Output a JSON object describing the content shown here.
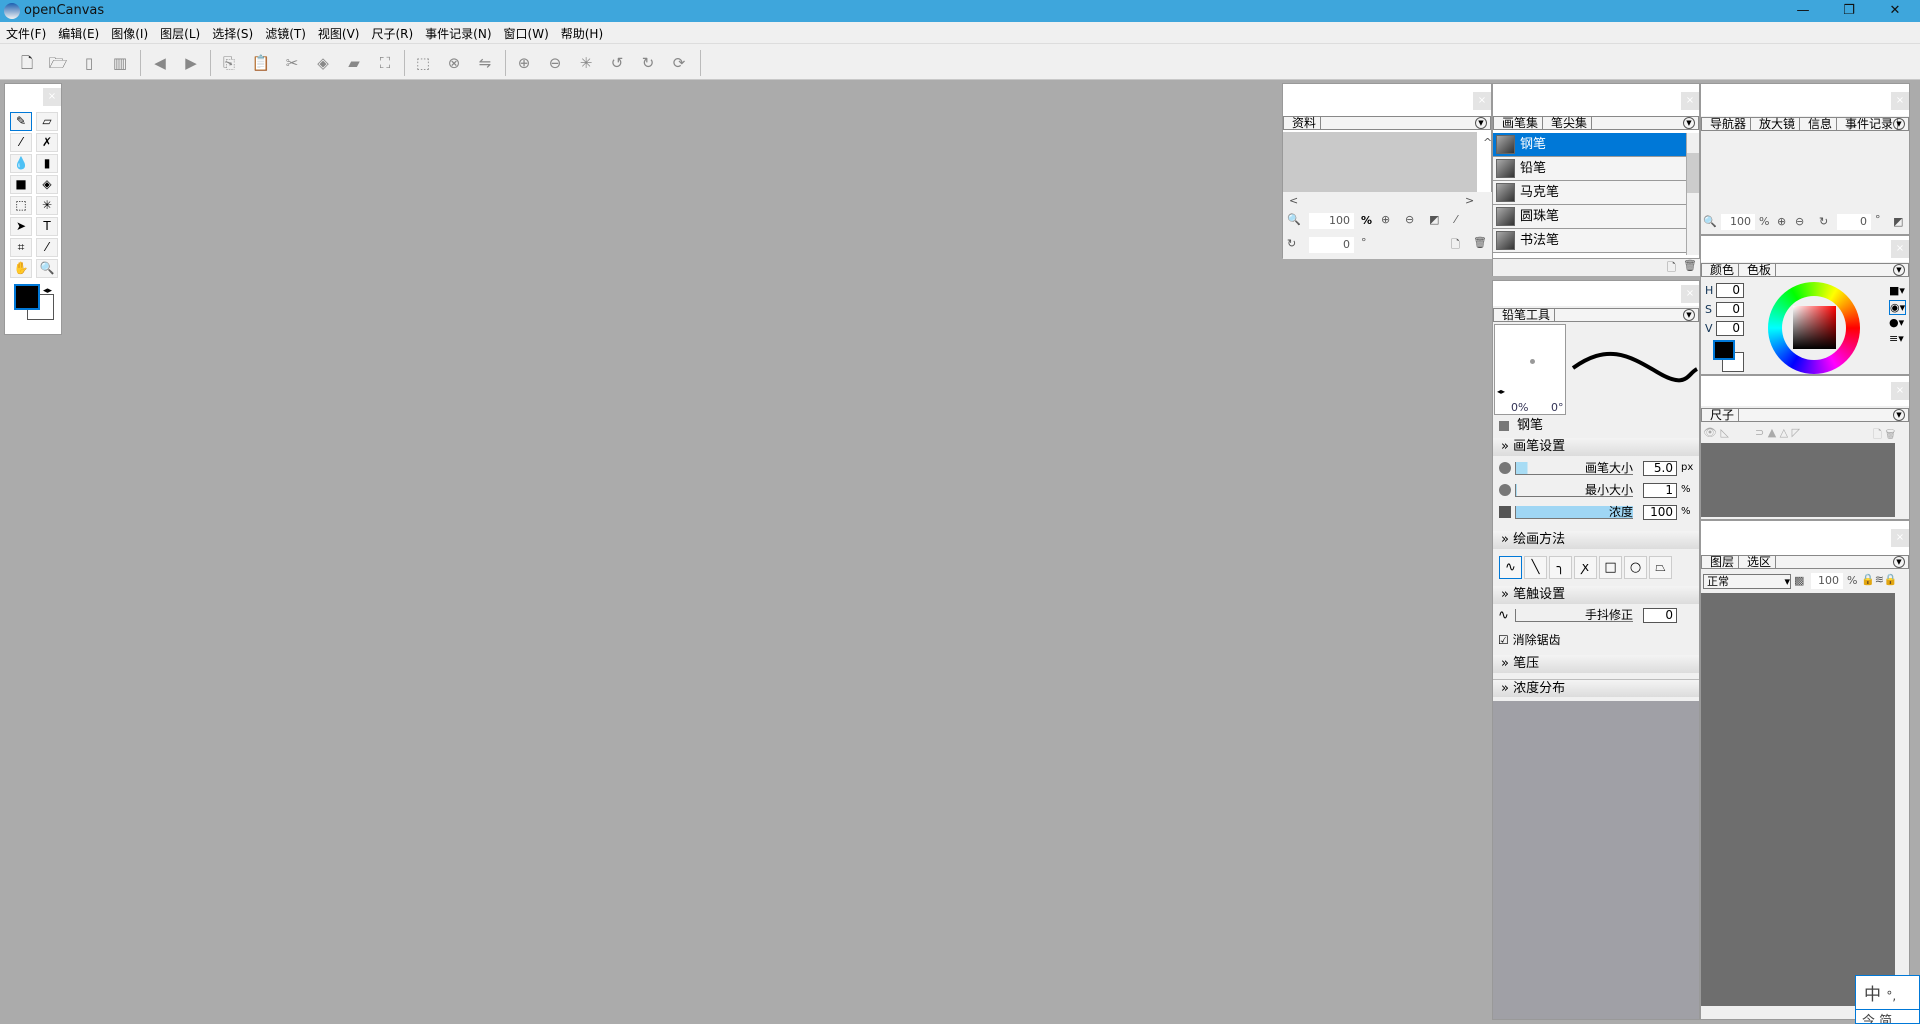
{
  "title": "openCanvas",
  "menu": [
    "文件(F)",
    "编辑(E)",
    "图像(I)",
    "图层(L)",
    "选择(S)",
    "滤镜(T)",
    "视图(V)",
    "尺子(R)",
    "事件记录(N)",
    "窗口(W)",
    "帮助(H)"
  ],
  "toolbar_icons": [
    "new-file",
    "open",
    "save",
    "save-as",
    "prev",
    "next",
    "copy",
    "paste",
    "cut",
    "fill",
    "erase",
    "transform",
    "select-all",
    "deselect",
    "invert-select",
    "zoom-in",
    "zoom-out",
    "fit",
    "rotate-left",
    "rotate-right",
    "reset-rotate"
  ],
  "material_panel": {
    "tab": "资料",
    "zoom": "100",
    "zoom_unit": "%",
    "rotate": "0",
    "rotate_unit": "°"
  },
  "brush_set_panel": {
    "tabs": [
      "画笔集",
      "笔尖集"
    ],
    "brushes": [
      "钢笔",
      "铅笔",
      "马克笔",
      "圆珠笔",
      "书法笔"
    ],
    "selected": "钢笔"
  },
  "tool_panel": {
    "tab": "铅笔工具",
    "preview_pct": "0%",
    "preview_deg": "0°",
    "brush_name": "钢笔",
    "sections": {
      "brush_settings": "画笔设置",
      "draw_method": "绘画方法",
      "stroke_settings": "笔触设置",
      "pressure": "笔压",
      "density_dist": "浓度分布"
    },
    "sliders": [
      {
        "label": "画笔大小",
        "value": "5.0",
        "unit": "px",
        "fill": 0.1
      },
      {
        "label": "最小大小",
        "value": "1",
        "unit": "%",
        "fill": 0.01
      },
      {
        "label": "浓度",
        "value": "100",
        "unit": "%",
        "fill": 1.0
      }
    ],
    "stabilizer": {
      "label": "手抖修正",
      "value": "0"
    },
    "antialias": {
      "label": "消除锯齿",
      "checked": true
    }
  },
  "navigator_panel": {
    "tabs": [
      "导航器",
      "放大镜",
      "信息",
      "事件记录"
    ],
    "zoom": "100",
    "zoom_unit": "%",
    "rotate": "0",
    "rotate_unit": "°"
  },
  "color_panel": {
    "tabs": [
      "颜色",
      "色板"
    ],
    "h_label": "H",
    "s_label": "S",
    "v_label": "V",
    "h": "0",
    "s": "0",
    "v": "0",
    "foreground": "#000000",
    "background": "#ffffff"
  },
  "ruler_panel": {
    "tab": "尺子"
  },
  "layer_panel": {
    "tabs": [
      "图层",
      "选区"
    ],
    "blend_mode": "正常",
    "opacity": "100",
    "opacity_unit": "%"
  },
  "ime": {
    "mode": "中",
    "punct": "°,",
    "bottom": "今 简"
  },
  "colors": {
    "titlebar": "#3ea6dc",
    "canvas_bg": "#ababab",
    "selection": "#0078d7"
  }
}
